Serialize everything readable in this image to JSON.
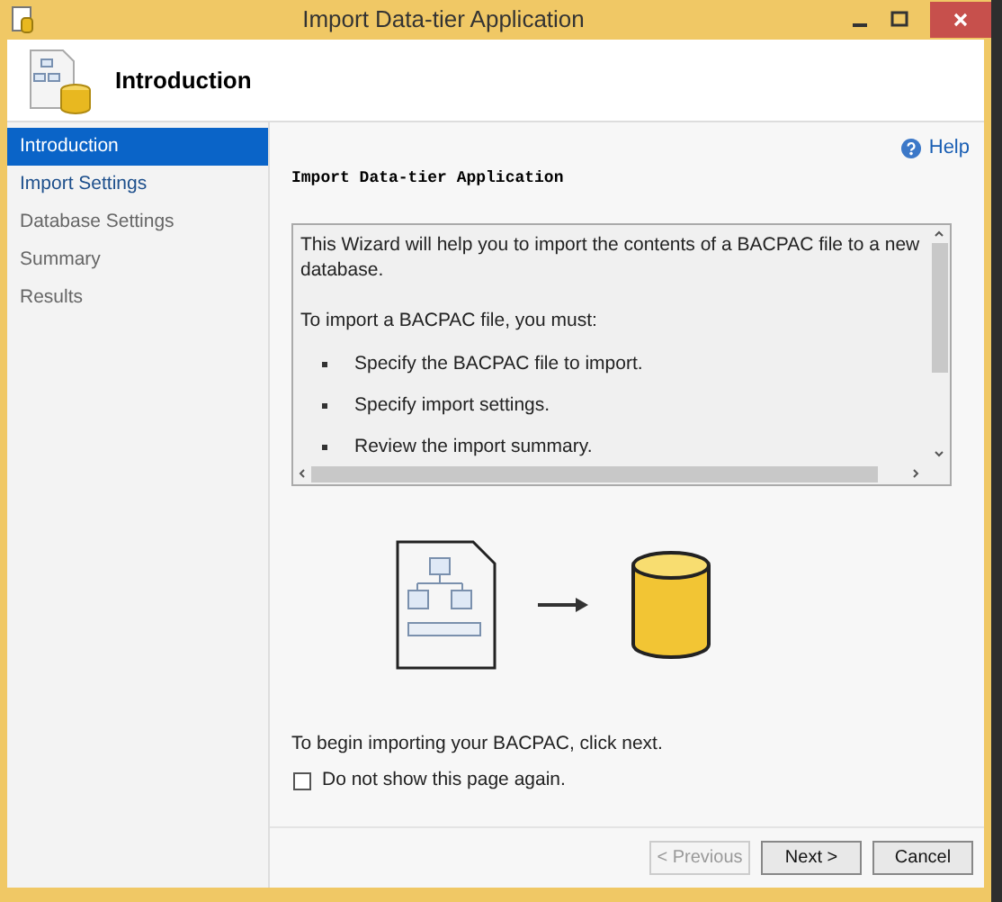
{
  "window": {
    "title": "Import Data-tier Application"
  },
  "header": {
    "title": "Introduction"
  },
  "sidebar": {
    "items": [
      {
        "label": "Introduction",
        "selected": true,
        "disabled": false
      },
      {
        "label": "Import Settings",
        "selected": false,
        "disabled": false
      },
      {
        "label": "Database Settings",
        "selected": false,
        "disabled": true
      },
      {
        "label": "Summary",
        "selected": false,
        "disabled": true
      },
      {
        "label": "Results",
        "selected": false,
        "disabled": true
      }
    ]
  },
  "help": {
    "label": "Help"
  },
  "page_heading": "Import Data-tier Application",
  "description": {
    "intro": "This Wizard will help you to import the contents of a BACPAC file to a new database.",
    "lead": "To import a BACPAC file, you must:",
    "steps": [
      "Specify the BACPAC file to import.",
      "Specify import settings.",
      "Review the import summary."
    ]
  },
  "footer_text": "To begin importing your BACPAC, click next.",
  "dont_show": {
    "label": "Do not show this page again.",
    "checked": false
  },
  "buttons": [
    {
      "label": "< Previous",
      "disabled": true
    },
    {
      "label": "Next >",
      "disabled": false
    },
    {
      "label": "Cancel",
      "disabled": false
    }
  ]
}
